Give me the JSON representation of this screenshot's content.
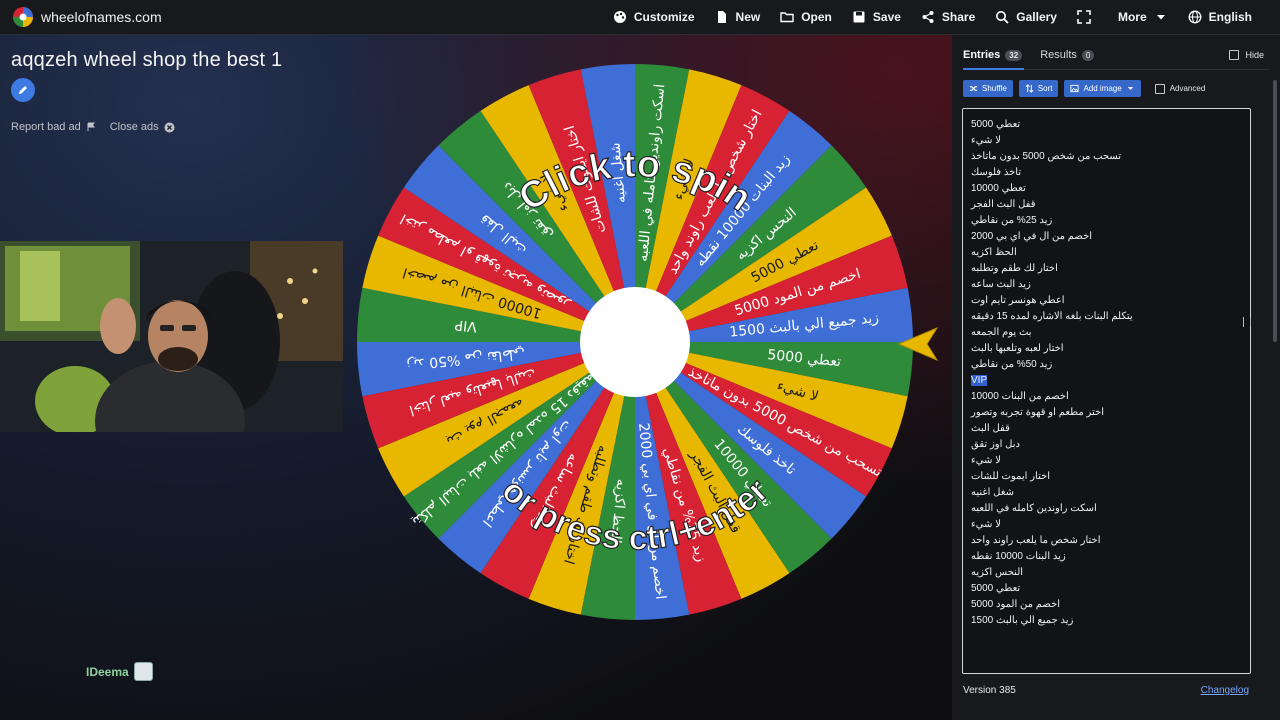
{
  "site": {
    "name": "wheelofnames.com"
  },
  "topnav": [
    {
      "label": "Customize",
      "icon": "palette-icon"
    },
    {
      "label": "New",
      "icon": "new-file-icon"
    },
    {
      "label": "Open",
      "icon": "folder-icon"
    },
    {
      "label": "Save",
      "icon": "save-icon"
    },
    {
      "label": "Share",
      "icon": "share-icon"
    },
    {
      "label": "Gallery",
      "icon": "search-icon"
    },
    {
      "label": "",
      "icon": "fullscreen-icon"
    },
    {
      "label": "More",
      "icon": "chevron-down-icon"
    },
    {
      "label": "English",
      "icon": "globe-icon"
    }
  ],
  "wheel": {
    "title": "aqqzeh wheel shop the best 1",
    "spin_top": "Click to spin",
    "spin_bottom": "or press ctrl+enter",
    "colors": [
      "#2e8b3a",
      "#e8b800",
      "#d62233",
      "#3f6fd6"
    ]
  },
  "ads": {
    "report": "Report bad ad",
    "close": "Close ads"
  },
  "viewer": {
    "name": "IDeema"
  },
  "panel": {
    "tab_entries": "Entries",
    "entries_count": "32",
    "tab_results": "Results",
    "results_count": "0",
    "hide_label": "Hide",
    "shuffle_label": "Shuffle",
    "sort_label": "Sort",
    "add_image_label": "Add image",
    "advanced_label": "Advanced",
    "version": "Version 385",
    "changelog": "Changelog"
  },
  "entries": [
    "تعطي 5000",
    "لا شيء",
    "تسحب من شخص 5000 بدون ماتاخذ",
    "تاخذ فلوسك",
    "تعطي 10000",
    "قفل البث الفجر",
    "زيد 25% من نقاطي",
    "اخصم من ال في اي بي 2000",
    "الحظ اكزيه",
    "اختار لك طقم وتطلبه",
    "زيد البث ساعه",
    "اعطي هونسر تايم اوت",
    "يتكلم البنات بلغه الاشاره لمده 15 دقيقه",
    "بث يوم الجمعه",
    "اختار لعبه وتلعبها بالبث",
    "زيد 50% من نقاطي",
    "VIP",
    "اخصم من البنات 10000",
    "اختر مطعم او قهوة تجربه وتصور",
    "قفل البث",
    "دبل اوز تقق",
    "لا شيء",
    "اختار ايموت للشات",
    "شغل اغنيه",
    "اسكت راوندين كامله في اللعبه",
    "لا شيء",
    "اختار شخص ما يلعب راوند واحد",
    "زيد البنات 10000 نقطه",
    "النحس اكزيه",
    "تعطي 5000",
    "اخصم من المود 5000",
    "زيد جميع الي بالبث 1500"
  ],
  "selected_entry_index": 16
}
